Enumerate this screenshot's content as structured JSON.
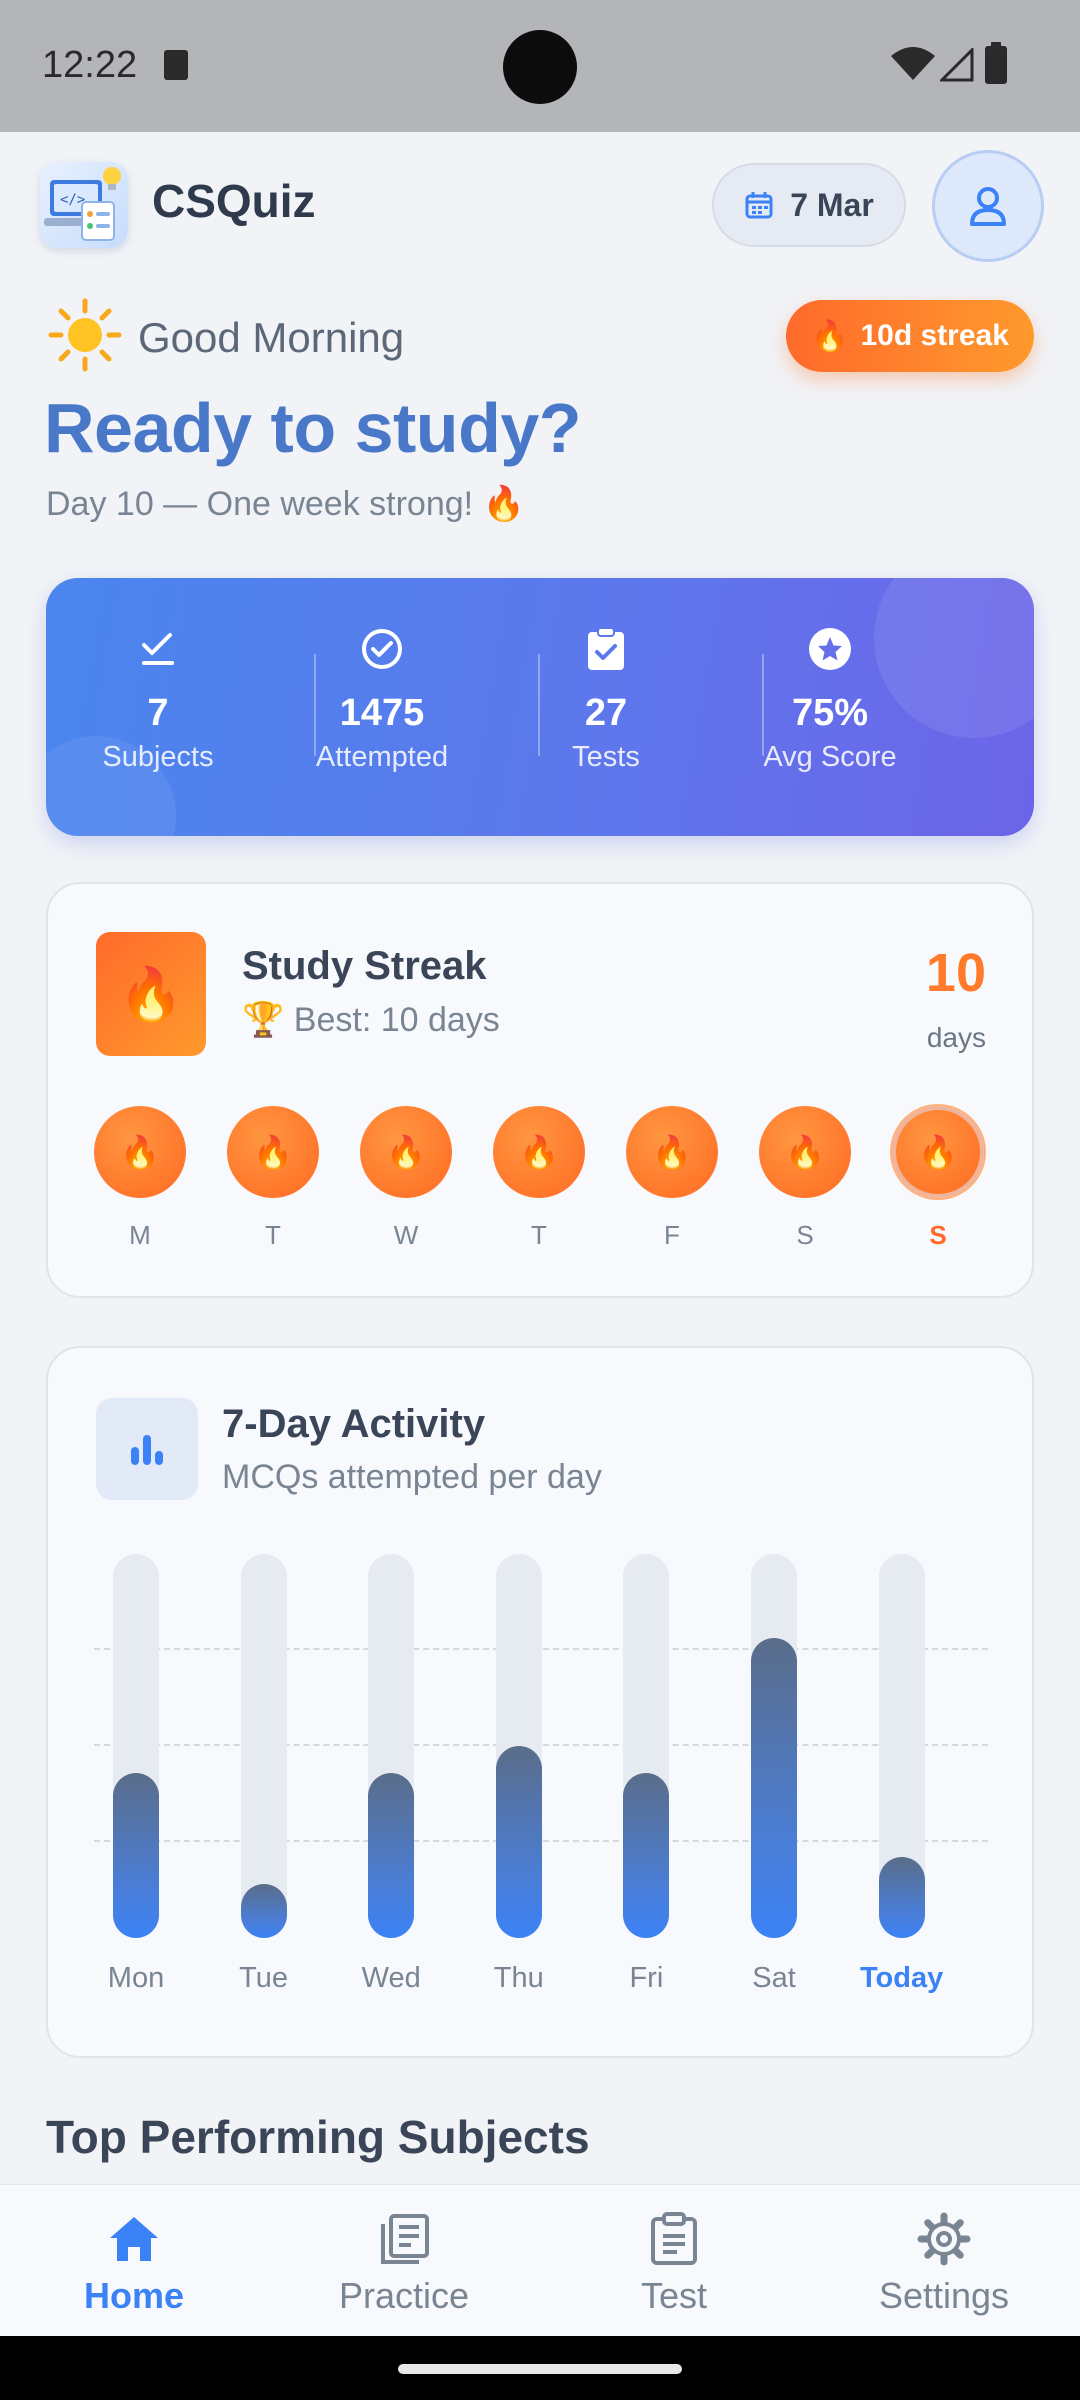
{
  "status_bar": {
    "time": "12:22"
  },
  "header": {
    "app_name": "CSQuiz",
    "date": "7 Mar"
  },
  "greeting": {
    "text": "Good Morning",
    "streak_badge": "10d streak",
    "headline": "Ready to study?",
    "subline": "Day 10 — One week strong! 🔥"
  },
  "stats": [
    {
      "value": "7",
      "label": "Subjects",
      "icon": "checklist-icon"
    },
    {
      "value": "1475",
      "label": "Attempted",
      "icon": "check-circle-icon"
    },
    {
      "value": "27",
      "label": "Tests",
      "icon": "clipboard-check-icon"
    },
    {
      "value": "75%",
      "label": "Avg Score",
      "icon": "star-circle-icon"
    }
  ],
  "streak": {
    "title": "Study Streak",
    "best": "🏆 Best: 10 days",
    "count": "10",
    "unit": "days",
    "days": [
      "M",
      "T",
      "W",
      "T",
      "F",
      "S",
      "S"
    ]
  },
  "activity": {
    "title": "7-Day Activity",
    "subtitle": "MCQs attempted per day"
  },
  "chart_data": {
    "type": "bar",
    "categories": [
      "Mon",
      "Tue",
      "Wed",
      "Thu",
      "Fri",
      "Sat",
      "Today"
    ],
    "values": [
      0.43,
      0.14,
      0.43,
      0.5,
      0.43,
      0.78,
      0.21
    ],
    "title": "",
    "xlabel": "",
    "ylabel": "",
    "ylim": [
      0,
      1
    ],
    "grid": true
  },
  "sections": {
    "top_subjects_title": "Top Performing Subjects"
  },
  "bottom_nav": [
    {
      "label": "Home",
      "icon": "home-icon",
      "active": true
    },
    {
      "label": "Practice",
      "icon": "practice-icon",
      "active": false
    },
    {
      "label": "Test",
      "icon": "test-clipboard-icon",
      "active": false
    },
    {
      "label": "Settings",
      "icon": "gear-icon",
      "active": false
    }
  ],
  "colors": {
    "accent": "#3b82f6",
    "streak_orange": "#ff7a2a",
    "stats_gradient_start": "#4a86ee",
    "stats_gradient_end": "#6c64e8"
  }
}
